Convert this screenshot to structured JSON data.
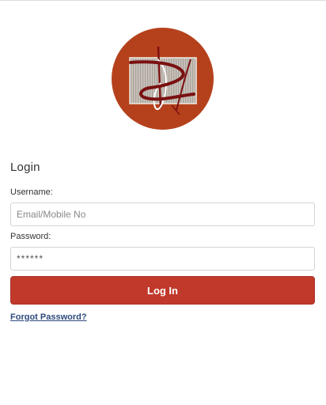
{
  "logo": {
    "icon": "brand-logo",
    "circle_color": "#b5411c",
    "panel_color": "#bdb6ae",
    "swoosh_color": "#7a1111"
  },
  "login": {
    "title": "Login",
    "username_label": "Username:",
    "username_placeholder": "Email/Mobile No",
    "password_label": "Password:",
    "password_placeholder": "******",
    "login_button": "Log In",
    "forgot_link": "Forgot Password?"
  },
  "colors": {
    "button": "#c0392b",
    "link": "#2e4a7d"
  }
}
